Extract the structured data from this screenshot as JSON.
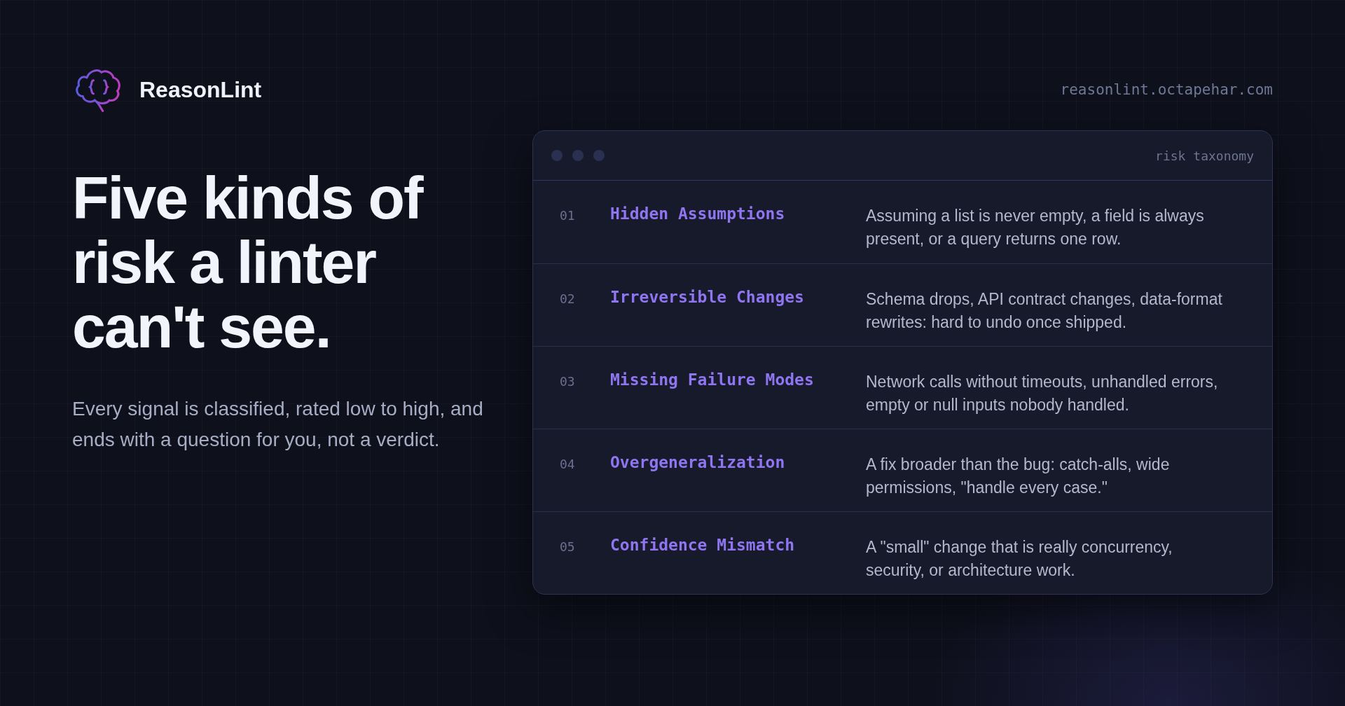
{
  "brand": {
    "name": "ReasonLint"
  },
  "site_url": "reasonlint.octapehar.com",
  "headline": "Five kinds of risk a linter can't see.",
  "subtitle": "Every signal is classified, rated low to high, and ends with a question for you, not a verdict.",
  "card": {
    "title": "risk taxonomy",
    "rows": [
      {
        "number": "01",
        "name": "Hidden Assumptions",
        "description": "Assuming a list is never empty, a field is always present, or a query returns one row."
      },
      {
        "number": "02",
        "name": "Irreversible Changes",
        "description": "Schema drops, API contract changes, data-format rewrites: hard to undo once shipped."
      },
      {
        "number": "03",
        "name": "Missing Failure Modes",
        "description": "Network calls without timeouts, unhandled errors, empty or null inputs nobody handled."
      },
      {
        "number": "04",
        "name": "Overgeneralization",
        "description": "A fix broader than the bug: catch-alls, wide permissions, \"handle every case.\""
      },
      {
        "number": "05",
        "name": "Confidence Mismatch",
        "description": "A \"small\" change that is really concurrency, security, or architecture work."
      }
    ]
  }
}
